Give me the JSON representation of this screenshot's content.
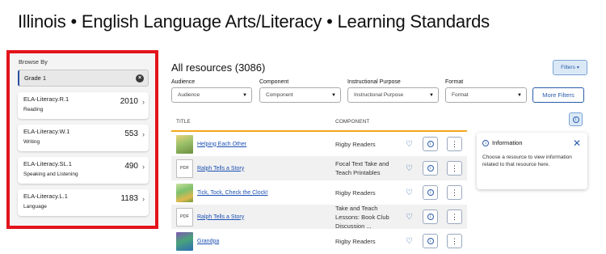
{
  "page_title": "Illinois • English Language Arts/Literacy • Learning Standards",
  "sidebar": {
    "browse_label": "Browse By",
    "grade": "Grade 1",
    "standards": [
      {
        "code": "ELA-Literacy.R.1",
        "subject": "Reading",
        "count": "2010"
      },
      {
        "code": "ELA-Literacy.W.1",
        "subject": "Writing",
        "count": "553"
      },
      {
        "code": "ELA-Literacy.SL.1",
        "subject": "Speaking and Listening",
        "count": "490"
      },
      {
        "code": "ELA-Literacy.L.1",
        "subject": "Language",
        "count": "1183"
      }
    ]
  },
  "main": {
    "all_resources": "All resources (3086)",
    "filters_button": "Filters",
    "more_filters": "More Filters",
    "filters": [
      {
        "label": "Audience",
        "value": "Audience"
      },
      {
        "label": "Component",
        "value": "Component"
      },
      {
        "label": "Instructional Purpose",
        "value": "Instructional Purpose"
      },
      {
        "label": "Format",
        "value": "Format"
      }
    ],
    "table": {
      "headers": {
        "title": "TITLE",
        "component": "COMPONENT"
      },
      "rows": [
        {
          "title": "Helping Each Other",
          "component": "Rigby Readers",
          "thumb": "image"
        },
        {
          "title": "Ralph Tells a Story",
          "component": "Focal Text Take and Teach Printables",
          "thumb": "PDF"
        },
        {
          "title": "Tick, Tock, Check the Clock!",
          "component": "Rigby Readers",
          "thumb": "image"
        },
        {
          "title": "Ralph Tells a Story",
          "component": "Take and Teach Lessons: Book Club Discussion ...",
          "thumb": "PDF"
        },
        {
          "title": "Grandpa",
          "component": "Rigby Readers",
          "thumb": "image"
        }
      ]
    }
  },
  "info_panel": {
    "title": "Information",
    "body": "Choose a resource to view information related to that resource here."
  },
  "colors": {
    "highlight_border": "#e3131b",
    "link": "#1a4fb3",
    "accent": "#2a5caa",
    "table_header_rule": "#f0a81e"
  }
}
